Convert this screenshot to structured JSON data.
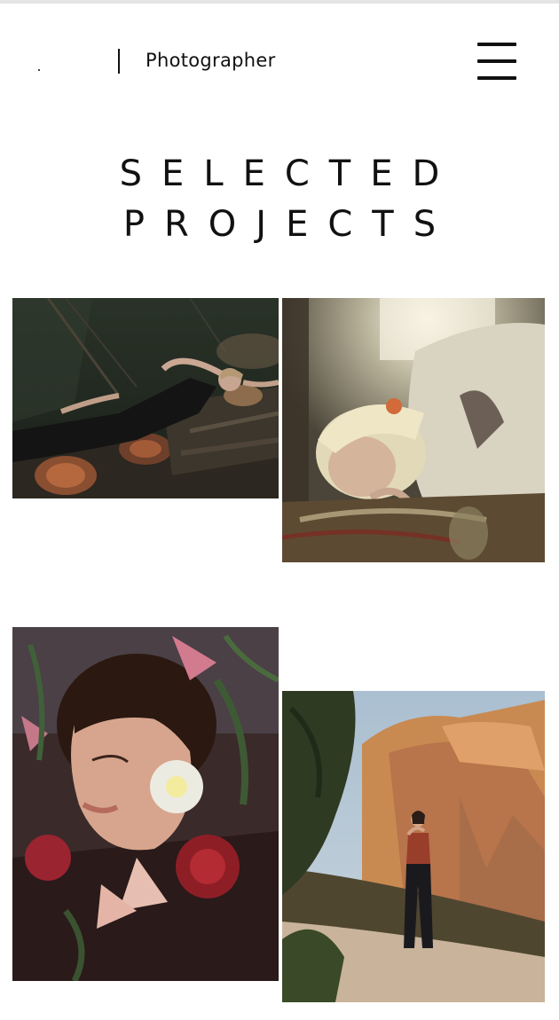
{
  "header": {
    "role": "Photographer",
    "menu_icon": "hamburger-menu-icon"
  },
  "hero": {
    "title_line1": "SELECTED",
    "title_line2": "PROJECTS"
  },
  "gallery": {
    "items": [
      {
        "subject": "woman-lying-on-logs-in-forest"
      },
      {
        "subject": "blonde-woman-lying-on-bed-in-sunlight"
      },
      {
        "subject": "woman-with-flowers-closeup"
      },
      {
        "subject": "woman-standing-in-canyon"
      }
    ]
  },
  "colors": {
    "text": "#111111",
    "background": "#ffffff"
  }
}
